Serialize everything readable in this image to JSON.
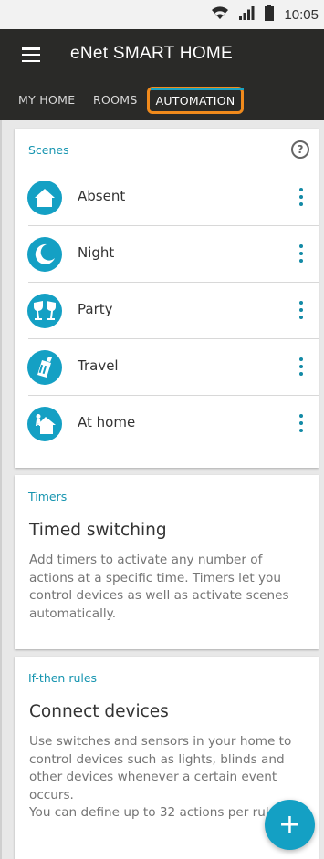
{
  "status_bar": {
    "time": "10:05",
    "icons": [
      "wifi-icon",
      "signal-icon",
      "battery-icon"
    ]
  },
  "app_bar": {
    "title": "eNet SMART HOME",
    "tabs": [
      {
        "label": "MY HOME",
        "selected": false
      },
      {
        "label": "ROOMS",
        "selected": false
      },
      {
        "label": "AUTOMATION",
        "selected": true
      }
    ]
  },
  "scenes": {
    "title": "Scenes",
    "items": [
      {
        "label": "Absent",
        "icon": "house-icon"
      },
      {
        "label": "Night",
        "icon": "moon-icon"
      },
      {
        "label": "Party",
        "icon": "glasses-icon"
      },
      {
        "label": "Travel",
        "icon": "luggage-icon"
      },
      {
        "label": "At home",
        "icon": "house-person-icon"
      }
    ]
  },
  "timers": {
    "title": "Timers",
    "heading": "Timed switching",
    "body": "Add timers to activate any number of actions at a specific time. Timers let you control devices as well as activate scenes automatically."
  },
  "ifthen": {
    "title": "If-then rules",
    "heading": "Connect devices",
    "body": "Use switches and sensors in your home to control devices such as lights, blinds and other devices whenever a certain event occurs.",
    "body2": "You can define up to 32 actions per rule."
  },
  "colors": {
    "accent": "#14a0c4",
    "appbar": "#2a2a28",
    "highlight": "#f08a1c"
  }
}
